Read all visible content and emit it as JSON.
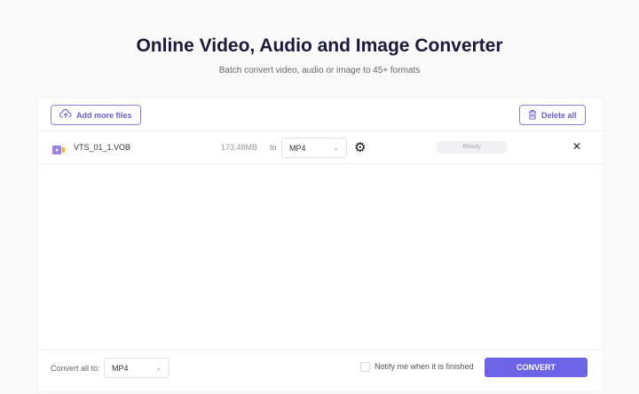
{
  "header": {
    "title": "Online Video, Audio and Image Converter",
    "subtitle": "Batch convert video, audio or image to 45+ formats"
  },
  "toolbar": {
    "add_label": "Add more files",
    "delete_label": "Delete all"
  },
  "files": [
    {
      "name": "VTS_01_1.VOB",
      "size": "173.48MB",
      "to": "to",
      "format": "MP4",
      "status": "Ready"
    }
  ],
  "footer": {
    "convert_all_label": "Convert all to:",
    "format": "MP4",
    "notify_label": "Notify me when it is finished",
    "convert_label": "CONVERT"
  },
  "colors": {
    "accent": "#6c63e6"
  }
}
